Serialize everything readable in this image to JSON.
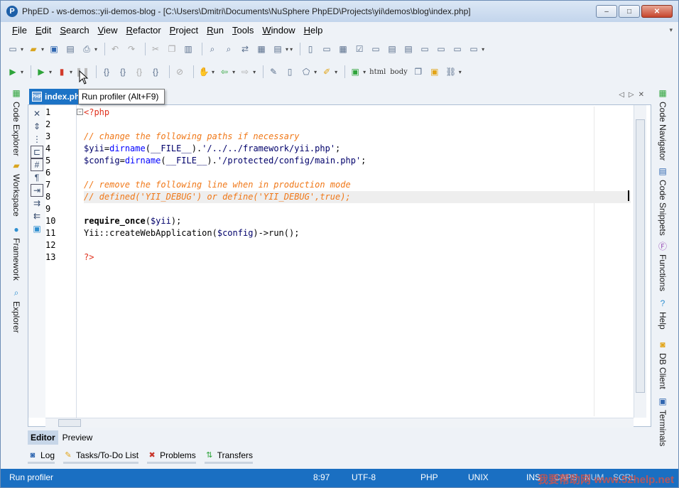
{
  "window": {
    "title": "PhpED - ws-demos::yii-demos-blog - [C:\\Users\\Dmitri\\Documents\\NuSphere PhpED\\Projects\\yii\\demos\\blog\\index.php]",
    "minimize": "–",
    "maximize": "□",
    "close": "✕"
  },
  "menu": [
    "File",
    "Edit",
    "Search",
    "View",
    "Refactor",
    "Project",
    "Run",
    "Tools",
    "Window",
    "Help"
  ],
  "toolbar2_text": {
    "html": "html",
    "body": "body"
  },
  "tooltip": "Run profiler (Alt+F9)",
  "left_panel": {
    "tabs": [
      {
        "label": "Code Explorer",
        "icon": "code-explorer-icon"
      },
      {
        "label": "Workspace",
        "icon": "workspace-icon"
      },
      {
        "label": "Framework",
        "icon": "framework-icon"
      },
      {
        "label": "Explorer",
        "icon": "explorer-icon"
      }
    ]
  },
  "right_panel": {
    "tabs": [
      {
        "label": "Code Navigator",
        "icon": "code-navigator-icon"
      },
      {
        "label": "Code Snippets",
        "icon": "code-snippets-icon"
      },
      {
        "label": "Functions",
        "icon": "functions-icon"
      },
      {
        "label": "Help",
        "icon": "help-icon"
      },
      {
        "label": "DB Client",
        "icon": "db-client-icon"
      },
      {
        "label": "Terminals",
        "icon": "terminals-icon"
      }
    ]
  },
  "editor": {
    "file_tab": "index.ph",
    "line_numbers": [
      "1",
      "2",
      "3",
      "4",
      "5",
      "6",
      "7",
      "8",
      "9",
      "10",
      "11",
      "12",
      "13"
    ],
    "lines": [
      [
        {
          "t": "<?php",
          "c": "c-tag"
        }
      ],
      [],
      [
        {
          "t": "// change the following paths if necessary",
          "c": "c-comment"
        }
      ],
      [
        {
          "t": "$yii",
          "c": "c-var"
        },
        {
          "t": "=",
          "c": "c-plain"
        },
        {
          "t": "dirname",
          "c": "c-fn"
        },
        {
          "t": "(",
          "c": "c-plain"
        },
        {
          "t": "__FILE__",
          "c": "c-var"
        },
        {
          "t": ").",
          "c": "c-plain"
        },
        {
          "t": "'/../../framework/yii.php'",
          "c": "c-var"
        },
        {
          "t": ";",
          "c": "c-plain"
        }
      ],
      [
        {
          "t": "$config",
          "c": "c-var"
        },
        {
          "t": "=",
          "c": "c-plain"
        },
        {
          "t": "dirname",
          "c": "c-fn"
        },
        {
          "t": "(",
          "c": "c-plain"
        },
        {
          "t": "__FILE__",
          "c": "c-var"
        },
        {
          "t": ").",
          "c": "c-plain"
        },
        {
          "t": "'/protected/config/main.php'",
          "c": "c-var"
        },
        {
          "t": ";",
          "c": "c-plain"
        }
      ],
      [],
      [
        {
          "t": "// remove the following line when in production mode",
          "c": "c-comment"
        }
      ],
      [
        {
          "t": "// defined('YII_DEBUG') or define('YII_DEBUG',true);",
          "c": "c-comment"
        }
      ],
      [],
      [
        {
          "t": "require_once",
          "c": "c-kw"
        },
        {
          "t": "(",
          "c": "c-plain"
        },
        {
          "t": "$yii",
          "c": "c-var"
        },
        {
          "t": ");",
          "c": "c-plain"
        }
      ],
      [
        {
          "t": "Yii::createWebApplication(",
          "c": "c-plain"
        },
        {
          "t": "$config",
          "c": "c-var"
        },
        {
          "t": ")->run();",
          "c": "c-plain"
        }
      ],
      [],
      [
        {
          "t": "?>",
          "c": "c-tag"
        }
      ]
    ],
    "highlighted_line": 8
  },
  "view_tabs": [
    "Editor",
    "Preview"
  ],
  "bottom_tabs": [
    {
      "label": "Log",
      "icon": "log-icon"
    },
    {
      "label": "Tasks/To-Do List",
      "icon": "tasks-icon"
    },
    {
      "label": "Problems",
      "icon": "problems-icon"
    },
    {
      "label": "Transfers",
      "icon": "transfers-icon"
    }
  ],
  "status": {
    "message": "Run profiler",
    "position": "8:97",
    "encoding": "UTF-8",
    "language": "PHP",
    "line_endings": "UNIX",
    "ins": "INS",
    "caps": "CAPS",
    "num": "NUM",
    "scrl": "SCRL",
    "watermark": "我要帮助网 www.52help.net"
  },
  "colors": {
    "accent": "#1a6fc2",
    "comment": "#f07818",
    "php_tag": "#e0321e"
  }
}
